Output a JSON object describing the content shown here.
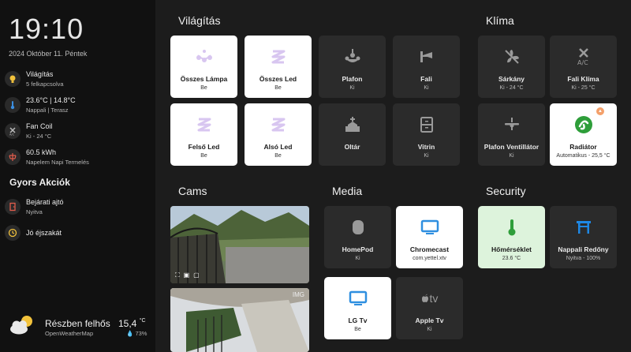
{
  "sidebar": {
    "clock": "19:10",
    "date": "2024 Október 11. Péntek",
    "items": [
      {
        "title": "Világítás",
        "sub": "5 felkapcsolva",
        "icon": "lightbulb-icon"
      },
      {
        "title": "23.6°C | 14.8°C",
        "sub": "Nappali | Terasz",
        "icon": "thermometer-icon"
      },
      {
        "title": "Fan Coil",
        "sub": "Ki - 24 °C",
        "icon": "fan-coil-icon"
      },
      {
        "title": "60.5 kWh",
        "sub": "Napelem Napi Termelés",
        "icon": "solar-power-icon"
      }
    ],
    "quick_actions_title": "Gyors Akciók",
    "quick_actions": [
      {
        "title": "Bejárati ajtó",
        "sub": "Nyitva",
        "icon": "door-icon"
      },
      {
        "title": "Jó éjszakát",
        "sub": "",
        "icon": "moon-clock-icon"
      }
    ],
    "weather": {
      "condition": "Részben felhős",
      "source": "OpenWeatherMap",
      "temp": "15,4",
      "unit": "°C",
      "humidity": "73%"
    }
  },
  "sections": {
    "lighting": "Világítás",
    "climate": "Klíma",
    "cams": "Cams",
    "media": "Media",
    "security": "Security"
  },
  "lighting_tiles": [
    {
      "name": "Összes Lámpa",
      "state": "Be",
      "icon": "chandelier-icon",
      "on": true
    },
    {
      "name": "Összes Led",
      "state": "Be",
      "icon": "led-strip-icon",
      "on": true
    },
    {
      "name": "Plafon",
      "state": "Ki",
      "icon": "ceiling-light-icon",
      "on": false
    },
    {
      "name": "Fali",
      "state": "Ki",
      "icon": "wall-light-icon",
      "on": false
    },
    {
      "name": "Felső Led",
      "state": "Be",
      "icon": "led-strip-icon",
      "on": true
    },
    {
      "name": "Alsó Led",
      "state": "Be",
      "icon": "led-strip-icon",
      "on": true
    },
    {
      "name": "Oltár",
      "state": "",
      "icon": "church-icon",
      "on": false
    },
    {
      "name": "Vitrin",
      "state": "Ki",
      "icon": "cabinet-icon",
      "on": false
    }
  ],
  "climate_tiles": [
    {
      "name": "Sárkány",
      "state": "Ki - 24 °C",
      "icon": "fan-off-icon"
    },
    {
      "name": "Fali Klíma",
      "state": "Ki - 25 °C",
      "icon": "air-conditioner-icon"
    },
    {
      "name": "Plafon Ventillátor",
      "state": "Ki",
      "icon": "ceiling-fan-icon"
    },
    {
      "name": "Radiátor",
      "state": "Automatikus - 25,5 °C",
      "icon": "radiator-icon",
      "badge": "flame"
    }
  ],
  "media_tiles": [
    {
      "name": "HomePod",
      "state": "Ki",
      "icon": "homepod-icon"
    },
    {
      "name": "Chromecast",
      "state": "com.yettel.xtv",
      "icon": "tv-icon"
    },
    {
      "name": "LG Tv",
      "state": "Be",
      "icon": "tv-icon"
    },
    {
      "name": "Apple Tv",
      "state": "Ki",
      "icon": "apple-tv-icon",
      "label": "tv"
    }
  ],
  "security_tiles": [
    {
      "name": "Hőmérséklet",
      "state": "23.6 °C",
      "icon": "thermometer-icon"
    },
    {
      "name": "Nappali Redőny",
      "state": "Nyitva - 100%",
      "icon": "blinds-icon"
    }
  ],
  "cams": {
    "second_label": "IMG"
  },
  "colors": {
    "sidebar_bg": "#111111",
    "main_bg": "#1c1c1c",
    "tile_off": "#2b2b2b",
    "tile_on": "#ffffff",
    "led_purple": "#d8c6f0",
    "tv_blue": "#2f8fe0",
    "green": "#2e9e3a",
    "green_tile": "#ddf3dc",
    "blinds_blue": "#1e88e5"
  }
}
